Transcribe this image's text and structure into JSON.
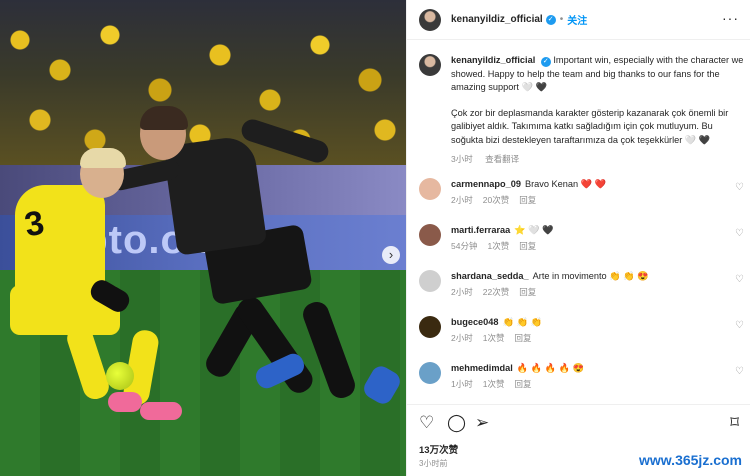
{
  "photo": {
    "banner_text": "ypto.om",
    "player_number_yellow": "3",
    "carousel_next_icon": "chevron-right-icon"
  },
  "header": {
    "username": "kenanyildiz_official",
    "follow_label": "关注",
    "more_label": "···"
  },
  "caption": {
    "username": "kenanyildiz_official",
    "text_en": "Important win, especially with the character we showed. Happy to help the team and big thanks to our fans for the amazing support 🤍 🖤",
    "text_tr": "Çok zor bir deplasmanda karakter gösterip kazanarak çok önemli bir galibiyet aldık. Takımıma katkı sağladığım için çok mutluyum. Bu soğukta bizi destekleyen taraftarımıza da çok teşekkürler 🤍 🖤",
    "time": "3小时",
    "translate_label": "查看翻译"
  },
  "comments": [
    {
      "user": "carmennapo_09",
      "text": "Bravo Kenan ❤️ ❤️",
      "time": "2小时",
      "likes": "20次赞",
      "reply": "回复",
      "avatar_color": "#e6b8a0"
    },
    {
      "user": "marti.ferraraa",
      "text": "⭐ 🤍 🖤",
      "time": "54分钟",
      "likes": "1次赞",
      "reply": "回复",
      "avatar_color": "#8a5a4a"
    },
    {
      "user": "shardana_sedda_",
      "text": "Arte in movimento 👏 👏 😍",
      "time": "2小时",
      "likes": "22次赞",
      "reply": "回复",
      "avatar_color": "#cfcfcf"
    },
    {
      "user": "bugece048",
      "text": "👏 👏 👏",
      "time": "2小时",
      "likes": "1次赞",
      "reply": "回复",
      "avatar_color": "#3a2a10"
    },
    {
      "user": "mehmedimdal",
      "text": "🔥 🔥 🔥 🔥 😍",
      "time": "1小时",
      "likes": "1次赞",
      "reply": "回复",
      "avatar_color": "#6aa0c8"
    }
  ],
  "actions": {
    "like_icon": "heart-icon",
    "comment_icon": "comment-icon",
    "share_icon": "send-icon",
    "save_icon": "bookmark-icon"
  },
  "post": {
    "likes": "13万次赞",
    "time": "3小时前"
  },
  "watermark": "www.365jz.com",
  "colors": {
    "link_blue": "#0095f6",
    "verified_blue": "#1d9bf0",
    "muted": "#8e8e8e"
  }
}
